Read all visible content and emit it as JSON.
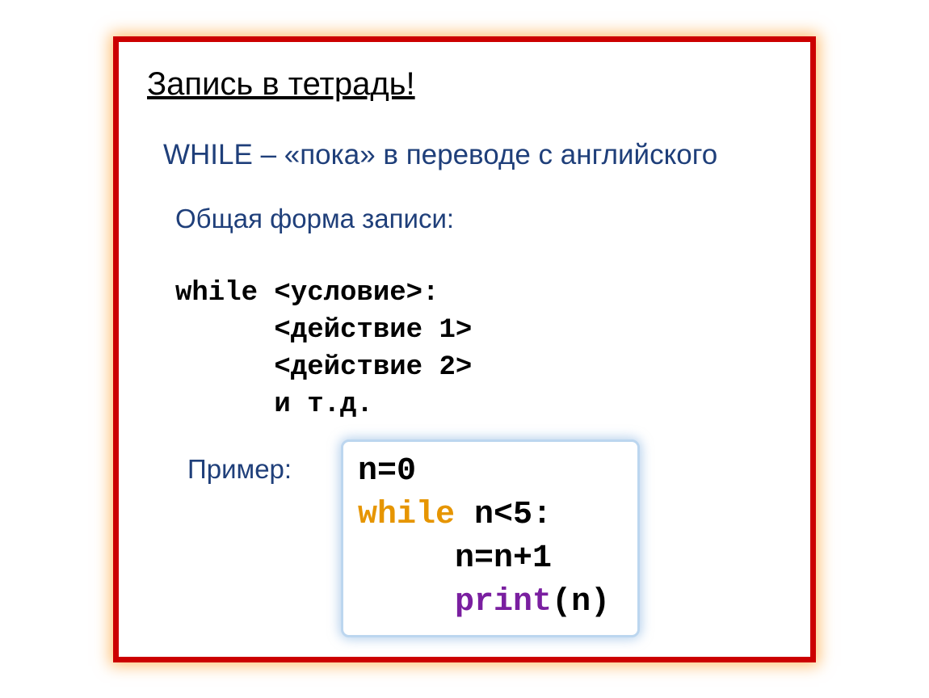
{
  "heading": "Запись в тетрадь!",
  "subhead": "WHILE – «пока» в переводе с английского",
  "form_label": "Общая форма записи:",
  "code_lines": {
    "l1": "while <условие>:",
    "l2": "      <действие 1>",
    "l3": "      <действие 2>",
    "l4": "      и т.д."
  },
  "example_label": "Пример:",
  "example": {
    "line1": "n=0",
    "line2_kw": "while",
    "line2_rest": " n<5:",
    "line3": "     n=n+1",
    "line4_indent": "     ",
    "line4_fn": "print",
    "line4_paren_open": "(",
    "line4_arg": "n",
    "line4_paren_close": ")"
  }
}
